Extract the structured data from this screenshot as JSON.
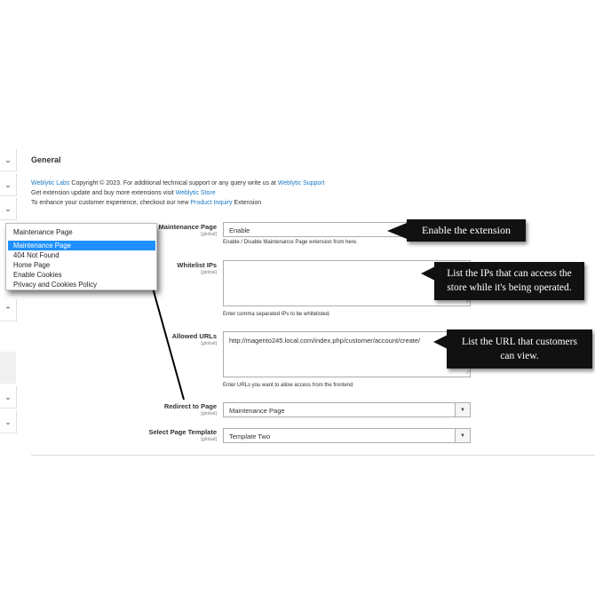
{
  "section": {
    "title": "General",
    "info": {
      "line1": {
        "link1": "Weblytic Labs",
        "text1": " Copyright © 2023. For additional technical support or any query write us at ",
        "link2": "Weblytic Support"
      },
      "line2": {
        "text1": "Get extension update and buy more extensions visit ",
        "link1": "Weblytic Store"
      },
      "line3": {
        "text1": "To enhance your customer experience, checkout our new ",
        "link1": "Product Inquiry",
        "text2": " Extension"
      }
    }
  },
  "fields": {
    "maintenance_page": {
      "label": "Maintenance Page",
      "scope": "[global]",
      "value": "Enable",
      "note": "Enable / Disable Maintenance Page extension from here."
    },
    "whitelist_ips": {
      "label": "Whitelist IPs",
      "scope": "[global]",
      "value": "",
      "note": "Enter comma separated IPs to be whitelisted."
    },
    "allowed_urls": {
      "label": "Allowed URLs",
      "scope": "[global]",
      "value": "http://magento245.local.com/index.php/customer/account/create/",
      "note": "Enter URLs you want to allow access from the frontend"
    },
    "redirect_to_page": {
      "label": "Redirect to Page",
      "scope": "[global]",
      "value": "Maintenance Page"
    },
    "page_template": {
      "label": "Select Page Template",
      "scope": "[global]",
      "value": "Template Two"
    }
  },
  "dropdown": {
    "current": "Maintenance Page",
    "options": [
      "Maintenance Page",
      "404 Not Found",
      "Home Page",
      "Enable Cookies",
      "Privacy and Cookies Policy"
    ],
    "selected_index": 0
  },
  "callouts": {
    "enable": "Enable the extension",
    "ips_line1": "List the IPs that can access the",
    "ips_line2": "store while it's being operated.",
    "url_line1": "List the URL that customers",
    "url_line2": "can view."
  },
  "colors": {
    "link": "#1979c3",
    "selected_option": "#1e90ff",
    "callout_bg": "#111111"
  }
}
